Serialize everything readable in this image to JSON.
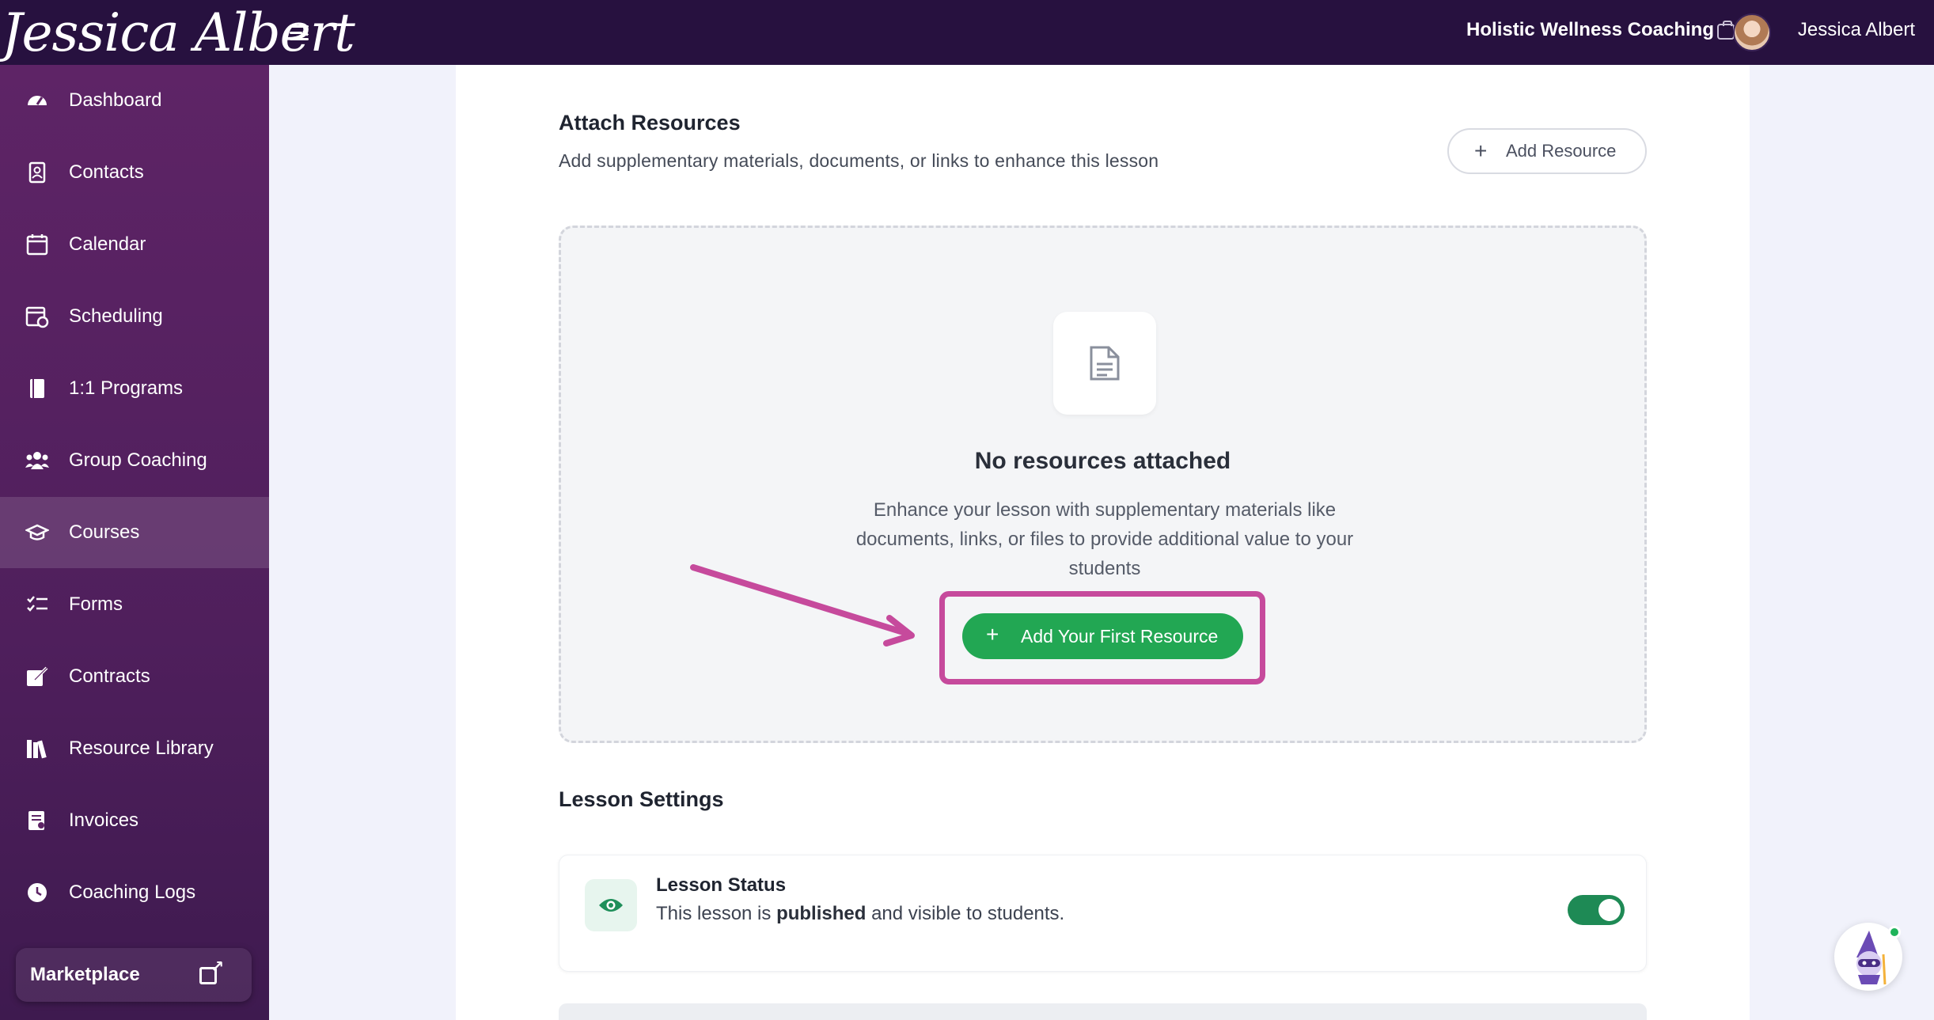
{
  "topbar": {
    "logo_text": "Jessica Albert",
    "business_name": "Holistic Wellness Coaching",
    "user_name": "Jessica Albert"
  },
  "sidebar": {
    "items": [
      {
        "label": "Dashboard",
        "icon": "dashboard-icon"
      },
      {
        "label": "Contacts",
        "icon": "contacts-icon"
      },
      {
        "label": "Calendar",
        "icon": "calendar-icon"
      },
      {
        "label": "Scheduling",
        "icon": "scheduling-icon"
      },
      {
        "label": "1:1 Programs",
        "icon": "book-icon"
      },
      {
        "label": "Group Coaching",
        "icon": "users-icon"
      },
      {
        "label": "Courses",
        "icon": "graduation-cap-icon",
        "active": true
      },
      {
        "label": "Forms",
        "icon": "checklist-icon"
      },
      {
        "label": "Contracts",
        "icon": "signature-icon"
      },
      {
        "label": "Resource Library",
        "icon": "library-icon"
      },
      {
        "label": "Invoices",
        "icon": "invoice-icon"
      },
      {
        "label": "Coaching Logs",
        "icon": "clock-icon"
      }
    ],
    "marketplace_label": "Marketplace"
  },
  "resources": {
    "title": "Attach Resources",
    "description": "Add supplementary materials, documents, or links to enhance this lesson",
    "add_button_label": "Add Resource",
    "empty_title": "No resources attached",
    "empty_description": "Enhance your lesson with supplementary materials like documents, links, or files to provide additional value to your students",
    "first_button_label": "Add Your First Resource"
  },
  "settings": {
    "title": "Lesson Settings",
    "status_title": "Lesson Status",
    "status_prefix": "This lesson is ",
    "status_bold": "published",
    "status_suffix": " and visible to students.",
    "published": true
  },
  "colors": {
    "topbar": "#27113f",
    "sidebar": "#5e2466",
    "primary_green": "#22a753",
    "highlight": "#c64a9c"
  }
}
